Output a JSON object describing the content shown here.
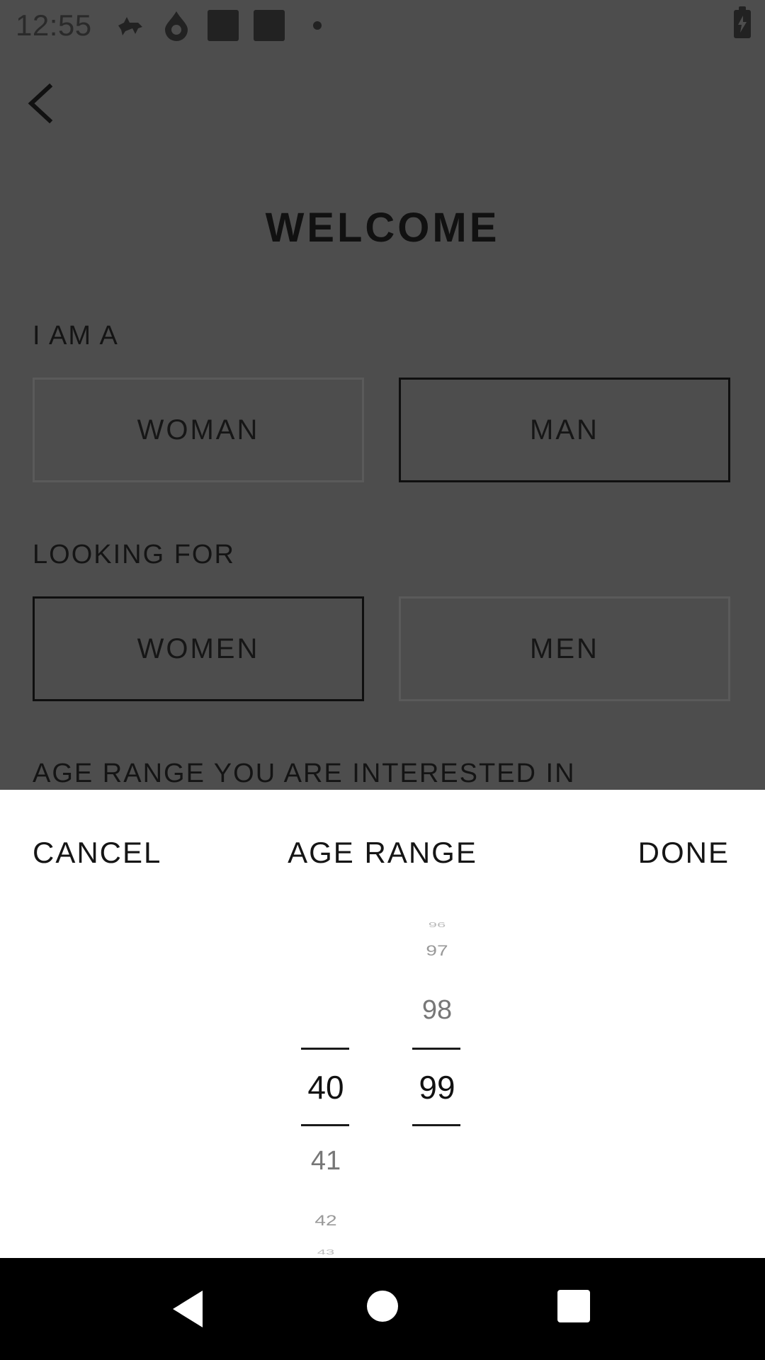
{
  "status_bar": {
    "time": "12:55",
    "icons": [
      "notification-app-icon",
      "water-drop-icon",
      "square-app-icon",
      "square-app-icon",
      "more-dot-icon",
      "battery-charging-icon"
    ]
  },
  "header": {
    "back_icon": "chevron-left-icon",
    "title": "WELCOME"
  },
  "iam": {
    "label": "I AM A",
    "options": [
      {
        "label": "WOMAN",
        "selected": false
      },
      {
        "label": "MAN",
        "selected": true
      }
    ]
  },
  "looking": {
    "label": "LOOKING FOR",
    "options": [
      {
        "label": "WOMEN",
        "selected": true
      },
      {
        "label": "MEN",
        "selected": false
      }
    ]
  },
  "age_section_label": "AGE RANGE YOU ARE INTERESTED IN",
  "sheet": {
    "cancel": "CANCEL",
    "title": "AGE RANGE",
    "done": "DONE",
    "min_wheel": {
      "selected": "40",
      "below": [
        "41",
        "42",
        "43"
      ]
    },
    "max_wheel": {
      "above": [
        "96",
        "97",
        "98"
      ],
      "selected": "99"
    }
  },
  "nav_bar": {
    "icons": [
      "back-triangle-icon",
      "home-circle-icon",
      "recents-square-icon"
    ]
  },
  "colors": {
    "dim_overlay_bg": "#4d4d4d",
    "sheet_bg": "#ffffff",
    "nav_bg": "#000000"
  }
}
